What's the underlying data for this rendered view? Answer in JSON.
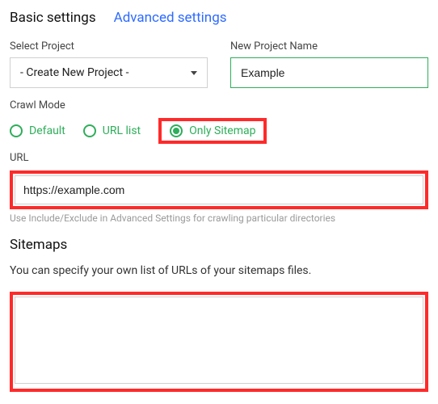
{
  "tabs": {
    "basic": "Basic settings",
    "advanced": "Advanced settings"
  },
  "project": {
    "select_label": "Select Project",
    "select_value": "- Create New Project -",
    "name_label": "New Project Name",
    "name_value": "Example"
  },
  "crawl_mode": {
    "label": "Crawl Mode",
    "options": {
      "default": "Default",
      "url_list": "URL list",
      "only_sitemap": "Only Sitemap"
    },
    "selected": "only_sitemap"
  },
  "url": {
    "label": "URL",
    "value": "https://example.com",
    "hint": "Use Include/Exclude in Advanced Settings for crawling particular directories"
  },
  "sitemaps": {
    "heading": "Sitemaps",
    "description": "You can specify your own list of URLs of your sitemaps files.",
    "value": ""
  }
}
